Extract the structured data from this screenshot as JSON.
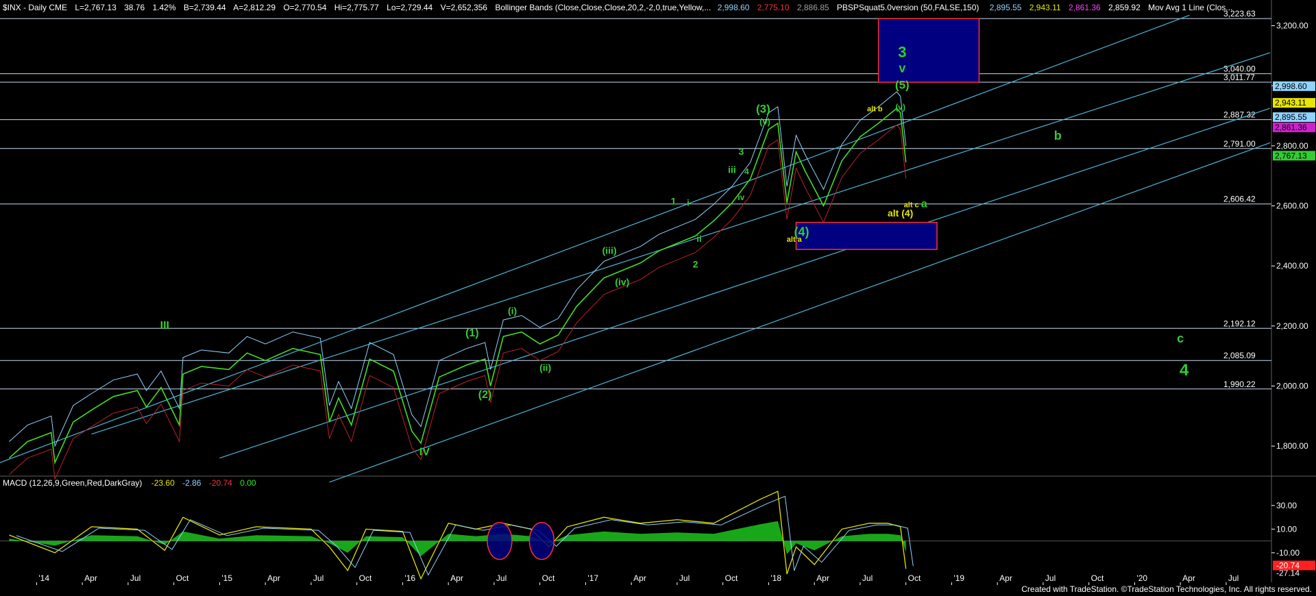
{
  "header": {
    "symbol": "$INX - Daily  CME",
    "last": "L=2,767.13",
    "change": "38.76",
    "change_pct": "1.42%",
    "bid": "B=2,739.44",
    "ask": "A=2,812.29",
    "open": "O=2,770.54",
    "high": "Hi=2,775.77",
    "low": "Lo=2,729.44",
    "volume": "V=2,652,356",
    "bb_label": "Bollinger Bands (Close,Close,Close,20,2,-2,0,true,Yellow,...",
    "bb_values": [
      "2,998.60",
      "2,775.10",
      "2,886.85"
    ],
    "pbs_label": "PBSPSquat5.0version (50,FALSE,150)",
    "pbs_values": [
      "2,895.55",
      "2,943.11",
      "2,861.36",
      "2,859.92"
    ],
    "ma_label": "Mov Avg 1 Line (Clos..."
  },
  "macd_header": {
    "label": "MACD (12,26,9,Green,Red,DarkGray)",
    "values": [
      "-23.60",
      "-2.86",
      "-20.74",
      "0.00"
    ]
  },
  "footer": {
    "credit": "Created with TradeStation. ©TradeStation Technologies, Inc. All rights reserved."
  },
  "colors": {
    "background": "#000000",
    "price": "#44dd22",
    "bb_cyan": "#8fd4ff",
    "bb_red": "#c0202a",
    "channel": "#49b8d8",
    "hline": "#c8dcf0",
    "wave_green": "#33cc33",
    "wave_yellow": "#e6e600",
    "box": "#000080",
    "box_border": "#ff3030",
    "macd_green": "#22ee22",
    "macd_red": "#ff2020"
  },
  "chart_data": {
    "type": "line",
    "title": "$INX - Daily CME",
    "y_axis": {
      "range": [
        1700,
        3240
      ],
      "tick_labels": [
        "1,800.00",
        "2,000.00",
        "2,200.00",
        "2,400.00",
        "2,600.00",
        "2,800.00",
        "3,000.00",
        "3,200.00"
      ],
      "tick_values": [
        1800,
        2000,
        2200,
        2400,
        2600,
        2800,
        3000,
        3200
      ]
    },
    "x_axis": {
      "tick_labels": [
        "'14",
        "Apr",
        "Jul",
        "Oct",
        "'15",
        "Apr",
        "Jul",
        "Oct",
        "'16",
        "Apr",
        "Jul",
        "Oct",
        "'17",
        "Apr",
        "Jul",
        "Oct",
        "'18",
        "Apr",
        "Jul",
        "Oct",
        "'19",
        "Apr",
        "Jul",
        "Oct",
        "'20",
        "Apr",
        "Jul"
      ],
      "tick_values": [
        2014.0,
        2014.25,
        2014.5,
        2014.75,
        2015.0,
        2015.25,
        2015.5,
        2015.75,
        2016.0,
        2016.25,
        2016.5,
        2016.75,
        2017.0,
        2017.25,
        2017.5,
        2017.75,
        2018.0,
        2018.25,
        2018.5,
        2018.75,
        2019.0,
        2019.25,
        2019.5,
        2019.75,
        2020.0,
        2020.25,
        2020.5
      ]
    },
    "price_series": {
      "name": "$INX",
      "x": [
        2013.85,
        2013.95,
        2014.08,
        2014.1,
        2014.2,
        2014.3,
        2014.42,
        2014.55,
        2014.6,
        2014.68,
        2014.78,
        2014.8,
        2014.9,
        2015.05,
        2015.15,
        2015.25,
        2015.4,
        2015.55,
        2015.6,
        2015.65,
        2015.72,
        2015.82,
        2015.95,
        2016.05,
        2016.1,
        2016.2,
        2016.35,
        2016.45,
        2016.48,
        2016.55,
        2016.65,
        2016.75,
        2016.85,
        2016.95,
        2017.1,
        2017.2,
        2017.3,
        2017.4,
        2017.5,
        2017.6,
        2017.7,
        2017.8,
        2017.9,
        2018.0,
        2018.05,
        2018.1,
        2018.15,
        2018.2,
        2018.3,
        2018.4,
        2018.5,
        2018.6,
        2018.7,
        2018.72,
        2018.75
      ],
      "y": [
        1760,
        1815,
        1845,
        1745,
        1880,
        1920,
        1965,
        1985,
        1930,
        1995,
        1870,
        2040,
        2065,
        2055,
        2110,
        2085,
        2125,
        2105,
        1880,
        1960,
        1870,
        2090,
        2050,
        1850,
        1810,
        2030,
        2070,
        2090,
        2000,
        2165,
        2180,
        2140,
        2170,
        2265,
        2360,
        2385,
        2410,
        2450,
        2475,
        2500,
        2550,
        2610,
        2690,
        2855,
        2875,
        2610,
        2780,
        2715,
        2600,
        2750,
        2830,
        2875,
        2925,
        2910,
        2745
      ]
    },
    "horizontal_levels": [
      {
        "label": "3,223.63",
        "value": 3223.63
      },
      {
        "label": "3,040.00",
        "value": 3040
      },
      {
        "label": "3,011.77",
        "value": 3011.77
      },
      {
        "label": "2,887.32",
        "value": 2887.32
      },
      {
        "label": "2,791.00",
        "value": 2791
      },
      {
        "label": "2,606.42",
        "value": 2606.42
      },
      {
        "label": "2,192.12",
        "value": 2192.12
      },
      {
        "label": "2,085.09",
        "value": 2085.09
      },
      {
        "label": "1,990.22",
        "value": 1990.22
      }
    ],
    "price_tags": [
      {
        "label": "2,998.60",
        "value": 2998.6,
        "color": "#8fd4ff"
      },
      {
        "label": "2,943.11",
        "value": 2943.11,
        "color": "#e6e600"
      },
      {
        "label": "2,895.55",
        "value": 2895.55,
        "color": "#8fd4ff"
      },
      {
        "label": "2,861.36",
        "value": 2861.36,
        "color": "#d020d0"
      },
      {
        "label": "2,767.13",
        "value": 2767.13,
        "color": "#33cc33"
      }
    ],
    "target_boxes": [
      {
        "x": [
          2018.6,
          2019.15
        ],
        "y": [
          3011.77,
          3223.63
        ]
      },
      {
        "x": [
          2018.15,
          2018.92
        ],
        "y": [
          2455,
          2545
        ]
      }
    ],
    "wave_labels": [
      {
        "text": "III",
        "x": 2014.7,
        "y": 2190,
        "color": "#33cc33",
        "size": 16
      },
      {
        "text": "IV",
        "x": 2016.12,
        "y": 1770,
        "color": "#33cc33",
        "size": 16
      },
      {
        "text": "(1)",
        "x": 2016.38,
        "y": 2165,
        "color": "#33cc33",
        "size": 16
      },
      {
        "text": "(2)",
        "x": 2016.45,
        "y": 1960,
        "color": "#33cc33",
        "size": 16
      },
      {
        "text": "(i)",
        "x": 2016.6,
        "y": 2240,
        "color": "#33cc33",
        "size": 14
      },
      {
        "text": "(ii)",
        "x": 2016.78,
        "y": 2050,
        "color": "#33cc33",
        "size": 14
      },
      {
        "text": "(iii)",
        "x": 2017.13,
        "y": 2440,
        "color": "#33cc33",
        "size": 14
      },
      {
        "text": "(iv)",
        "x": 2017.2,
        "y": 2335,
        "color": "#33cc33",
        "size": 14
      },
      {
        "text": "(3)",
        "x": 2017.97,
        "y": 2910,
        "color": "#33cc33",
        "size": 17
      },
      {
        "text": "(v)",
        "x": 2017.98,
        "y": 2870,
        "color": "#33cc33",
        "size": 13
      },
      {
        "text": "(4)",
        "x": 2018.18,
        "y": 2500,
        "color": "#33cc33",
        "size": 18
      },
      {
        "text": "(5)",
        "x": 2018.73,
        "y": 2990,
        "color": "#33cc33",
        "size": 17
      },
      {
        "text": "(v)",
        "x": 2018.72,
        "y": 2920,
        "color": "#33cc33",
        "size": 12
      },
      {
        "text": "3",
        "x": 2018.73,
        "y": 3095,
        "color": "#33cc33",
        "size": 22
      },
      {
        "text": "v",
        "x": 2018.73,
        "y": 3045,
        "color": "#33cc33",
        "size": 18
      },
      {
        "text": "1",
        "x": 2017.48,
        "y": 2605,
        "color": "#33cc33",
        "size": 14
      },
      {
        "text": "2",
        "x": 2017.6,
        "y": 2395,
        "color": "#33cc33",
        "size": 14
      },
      {
        "text": "3",
        "x": 2017.85,
        "y": 2770,
        "color": "#33cc33",
        "size": 14
      },
      {
        "text": "4",
        "x": 2017.88,
        "y": 2705,
        "color": "#33cc33",
        "size": 12
      },
      {
        "text": "iii",
        "x": 2017.8,
        "y": 2710,
        "color": "#33cc33",
        "size": 14
      },
      {
        "text": "iv",
        "x": 2017.85,
        "y": 2620,
        "color": "#33cc33",
        "size": 12
      },
      {
        "text": "i",
        "x": 2017.56,
        "y": 2600,
        "color": "#33cc33",
        "size": 13
      },
      {
        "text": "ii",
        "x": 2017.62,
        "y": 2480,
        "color": "#33cc33",
        "size": 13
      },
      {
        "text": "a",
        "x": 2018.85,
        "y": 2595,
        "color": "#33cc33",
        "size": 16
      },
      {
        "text": "b",
        "x": 2019.58,
        "y": 2820,
        "color": "#33cc33",
        "size": 18
      },
      {
        "text": "c",
        "x": 2020.25,
        "y": 2145,
        "color": "#33cc33",
        "size": 18
      },
      {
        "text": "4",
        "x": 2020.27,
        "y": 2035,
        "color": "#33cc33",
        "size": 24
      },
      {
        "text": "alt b",
        "x": 2018.58,
        "y": 2915,
        "color": "#e6e600",
        "size": 11
      },
      {
        "text": "alt a",
        "x": 2018.14,
        "y": 2480,
        "color": "#e6e600",
        "size": 11
      },
      {
        "text": "alt c",
        "x": 2018.78,
        "y": 2595,
        "color": "#e6e600",
        "size": 11
      },
      {
        "text": "alt (4)",
        "x": 2018.72,
        "y": 2565,
        "color": "#e6e600",
        "size": 14
      }
    ],
    "macd": {
      "label": "MACD (12,26,9,Green,Red,DarkGray)",
      "y_range": [
        -35,
        45
      ],
      "tick_labels": [
        "30.00",
        "10.00",
        "-10.00",
        "-27.14",
        "-20.74"
      ],
      "tick_values": [
        30,
        10,
        -10,
        -27.14,
        -20.74
      ],
      "x": [
        2013.85,
        2014.1,
        2014.3,
        2014.55,
        2014.7,
        2014.8,
        2015.0,
        2015.2,
        2015.5,
        2015.6,
        2015.7,
        2015.8,
        2016.0,
        2016.1,
        2016.25,
        2016.4,
        2016.55,
        2016.7,
        2016.8,
        2016.9,
        2017.1,
        2017.3,
        2017.5,
        2017.7,
        2017.95,
        2018.05,
        2018.1,
        2018.15,
        2018.25,
        2018.4,
        2018.55,
        2018.65,
        2018.72,
        2018.75
      ],
      "values": [
        5,
        -10,
        12,
        10,
        -8,
        20,
        5,
        12,
        10,
        -5,
        -25,
        10,
        8,
        -32,
        15,
        10,
        15,
        10,
        -5,
        12,
        20,
        15,
        18,
        15,
        35,
        42,
        -28,
        -5,
        -20,
        10,
        15,
        15,
        12,
        -23.6
      ]
    },
    "highlight_circles": [
      {
        "x": 2016.53,
        "y": 0
      },
      {
        "x": 2016.76,
        "y": 0
      }
    ]
  }
}
